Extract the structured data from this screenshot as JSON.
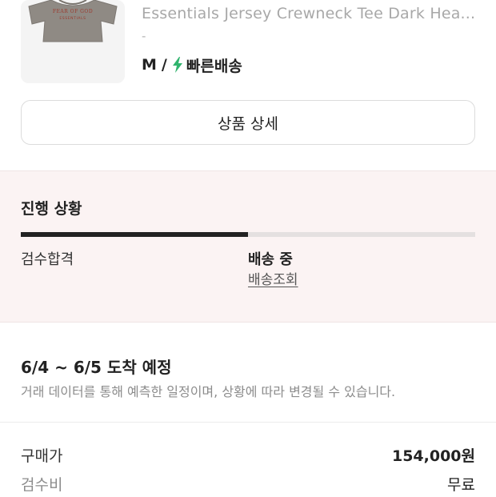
{
  "product": {
    "name": "Essentials Jersey Crewneck Tee Dark Hea...",
    "sub": "-",
    "size": "M",
    "separator": "/",
    "shipping": "빠른배송",
    "thumb_text_top": "FEAR OF GOD",
    "thumb_text_bottom": "ESSENTIALS"
  },
  "detail_button": {
    "label": "상품 상세"
  },
  "progress": {
    "title": "진행 상황",
    "fill_fraction": 0.5,
    "steps": [
      "검수합격",
      "배송 중"
    ],
    "track_link": "배송조회"
  },
  "eta": {
    "title": "6/4 ~ 6/5 도착 예정",
    "note": "거래 데이터를 통해 예측한 일정이며, 상황에 따라 변경될 수 있습니다."
  },
  "prices": {
    "buy_label": "구매가",
    "buy_value": "154,000원",
    "inspect_label": "검수비",
    "inspect_value": "무료"
  },
  "colors": {
    "accent_green": "#31b46e",
    "progress_bg": "#fbf3f3",
    "shirt": "#8f8a84",
    "shirt_print": "#9b3a2e"
  }
}
